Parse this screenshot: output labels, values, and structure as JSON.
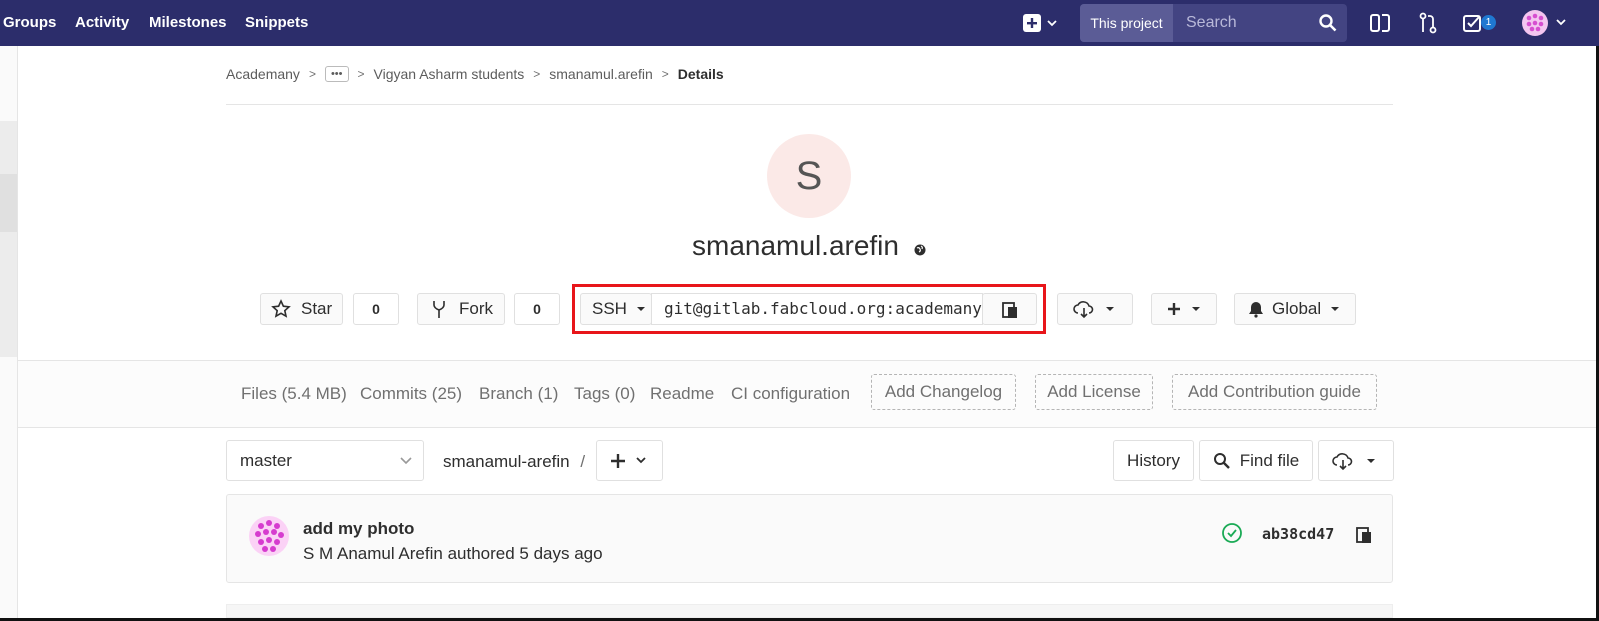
{
  "topnav": {
    "links": [
      "Groups",
      "Activity",
      "Milestones",
      "Snippets"
    ],
    "search_scope": "This project",
    "search_placeholder": "Search",
    "todo_count": "1"
  },
  "breadcrumb": {
    "items": [
      "Academany",
      "Vigyan Asharm students",
      "smanamul.arefin"
    ],
    "ellipsis": "•••",
    "current": "Details"
  },
  "project": {
    "avatar_letter": "S",
    "name": "smanamul.arefin",
    "star_label": "Star",
    "star_count": "0",
    "fork_label": "Fork",
    "fork_count": "0",
    "clone_protocol": "SSH",
    "clone_url": "git@gitlab.fabcloud.org:academany",
    "notification_label": "Global"
  },
  "stats": {
    "files": "Files (5.4 MB)",
    "commits": "Commits (25)",
    "branch": "Branch (1)",
    "tags": "Tags (0)",
    "readme": "Readme",
    "ci": "CI configuration",
    "add_changelog": "Add Changelog",
    "add_license": "Add License",
    "add_contribution": "Add Contribution guide"
  },
  "tree": {
    "branch": "master",
    "path": "smanamul-arefin",
    "path_sep": "/",
    "history_label": "History",
    "find_file_label": "Find file"
  },
  "commit": {
    "title": "add my photo",
    "meta": "S M Anamul Arefin authored 5 days ago",
    "sha": "ab38cd47"
  },
  "colors": {
    "nav_bg": "#2c2d6b",
    "highlight_border": "#e8151a",
    "pipeline_success": "#1aaa55"
  }
}
